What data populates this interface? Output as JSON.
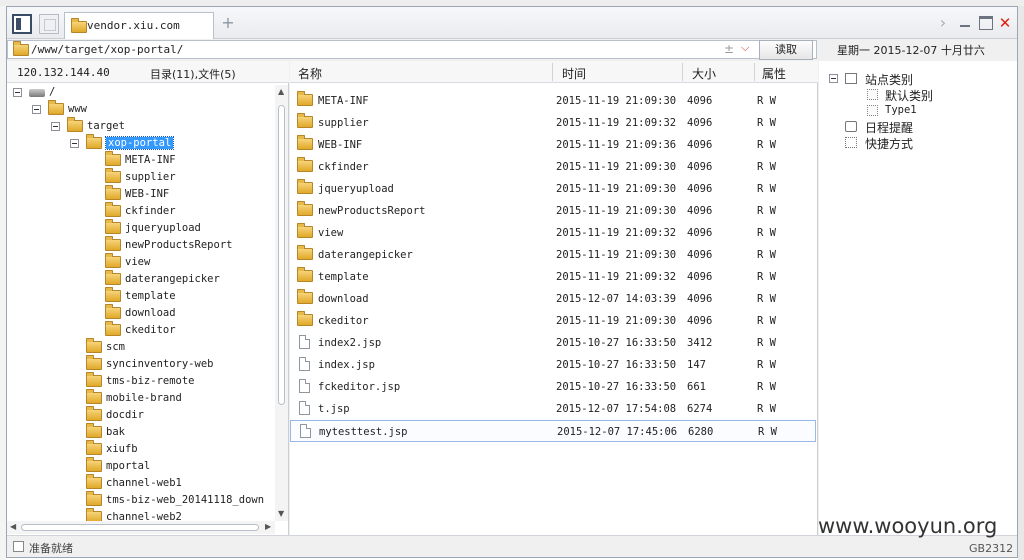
{
  "tab": {
    "title": "vendor.xiu.com"
  },
  "address": {
    "path": "/www/target/xop-portal/",
    "pm_glyph": "±",
    "dropdown_glyph": "⌵"
  },
  "toolbar": {
    "read_label": "读取"
  },
  "date_display": "星期一  2015-12-07  十月廿六",
  "left_panel": {
    "ip": "120.132.144.40",
    "dir_count": "目录(11),文件(5)"
  },
  "tree": [
    {
      "label": "/",
      "level": 0,
      "type": "drive",
      "expanded": true
    },
    {
      "label": "www",
      "level": 1,
      "type": "folder",
      "expanded": true
    },
    {
      "label": "target",
      "level": 2,
      "type": "folder",
      "expanded": true
    },
    {
      "label": "xop-portal",
      "level": 3,
      "type": "folder",
      "expanded": true,
      "selected": true
    },
    {
      "label": "META-INF",
      "level": 4,
      "type": "folder"
    },
    {
      "label": "supplier",
      "level": 4,
      "type": "folder"
    },
    {
      "label": "WEB-INF",
      "level": 4,
      "type": "folder"
    },
    {
      "label": "ckfinder",
      "level": 4,
      "type": "folder"
    },
    {
      "label": "jqueryupload",
      "level": 4,
      "type": "folder"
    },
    {
      "label": "newProductsReport",
      "level": 4,
      "type": "folder"
    },
    {
      "label": "view",
      "level": 4,
      "type": "folder"
    },
    {
      "label": "daterangepicker",
      "level": 4,
      "type": "folder"
    },
    {
      "label": "template",
      "level": 4,
      "type": "folder"
    },
    {
      "label": "download",
      "level": 4,
      "type": "folder"
    },
    {
      "label": "ckeditor",
      "level": 4,
      "type": "folder"
    },
    {
      "label": "scm",
      "level": 3,
      "type": "folder"
    },
    {
      "label": "syncinventory-web",
      "level": 3,
      "type": "folder"
    },
    {
      "label": "tms-biz-remote",
      "level": 3,
      "type": "folder"
    },
    {
      "label": "mobile-brand",
      "level": 3,
      "type": "folder"
    },
    {
      "label": "docdir",
      "level": 3,
      "type": "folder"
    },
    {
      "label": "bak",
      "level": 3,
      "type": "folder"
    },
    {
      "label": "xiufb",
      "level": 3,
      "type": "folder"
    },
    {
      "label": "mportal",
      "level": 3,
      "type": "folder"
    },
    {
      "label": "channel-web1",
      "level": 3,
      "type": "folder"
    },
    {
      "label": "tms-biz-web_20141118_down",
      "level": 3,
      "type": "folder"
    },
    {
      "label": "channel-web2",
      "level": 3,
      "type": "folder"
    }
  ],
  "list_columns": {
    "name": "名称",
    "time": "时间",
    "size": "大小",
    "attr": "属性"
  },
  "files": [
    {
      "name": "META-INF",
      "time": "2015-11-19 21:09:30",
      "size": "4096",
      "attr": "R W",
      "type": "folder"
    },
    {
      "name": "supplier",
      "time": "2015-11-19 21:09:32",
      "size": "4096",
      "attr": "R W",
      "type": "folder"
    },
    {
      "name": "WEB-INF",
      "time": "2015-11-19 21:09:36",
      "size": "4096",
      "attr": "R W",
      "type": "folder"
    },
    {
      "name": "ckfinder",
      "time": "2015-11-19 21:09:30",
      "size": "4096",
      "attr": "R W",
      "type": "folder"
    },
    {
      "name": "jqueryupload",
      "time": "2015-11-19 21:09:30",
      "size": "4096",
      "attr": "R W",
      "type": "folder"
    },
    {
      "name": "newProductsReport",
      "time": "2015-11-19 21:09:30",
      "size": "4096",
      "attr": "R W",
      "type": "folder"
    },
    {
      "name": "view",
      "time": "2015-11-19 21:09:32",
      "size": "4096",
      "attr": "R W",
      "type": "folder"
    },
    {
      "name": "daterangepicker",
      "time": "2015-11-19 21:09:30",
      "size": "4096",
      "attr": "R W",
      "type": "folder"
    },
    {
      "name": "template",
      "time": "2015-11-19 21:09:32",
      "size": "4096",
      "attr": "R W",
      "type": "folder"
    },
    {
      "name": "download",
      "time": "2015-12-07 14:03:39",
      "size": "4096",
      "attr": "R W",
      "type": "folder"
    },
    {
      "name": "ckeditor",
      "time": "2015-11-19 21:09:30",
      "size": "4096",
      "attr": "R W",
      "type": "folder"
    },
    {
      "name": "index2.jsp",
      "time": "2015-10-27 16:33:50",
      "size": "3412",
      "attr": "R W",
      "type": "file"
    },
    {
      "name": "index.jsp",
      "time": "2015-10-27 16:33:50",
      "size": "147",
      "attr": "R W",
      "type": "file"
    },
    {
      "name": "fckeditor.jsp",
      "time": "2015-10-27 16:33:50",
      "size": "661",
      "attr": "R W",
      "type": "file"
    },
    {
      "name": "t.jsp",
      "time": "2015-12-07 17:54:08",
      "size": "6274",
      "attr": "R W",
      "type": "file"
    },
    {
      "name": "mytesttest.jsp",
      "time": "2015-12-07 17:45:06",
      "size": "6280",
      "attr": "R W",
      "type": "file",
      "selected": true
    }
  ],
  "right_panel": {
    "site_category": "站点类别",
    "default_category": "默认类别",
    "type1": "Type1",
    "schedule": "日程提醒",
    "shortcuts": "快捷方式"
  },
  "status": {
    "text": "准备就绪",
    "encoding": "GB2312"
  },
  "watermark": "www.wooyun.org",
  "colors": {
    "selection": "#3399ff",
    "folder": "#e0a928",
    "close": "#dd2211"
  }
}
